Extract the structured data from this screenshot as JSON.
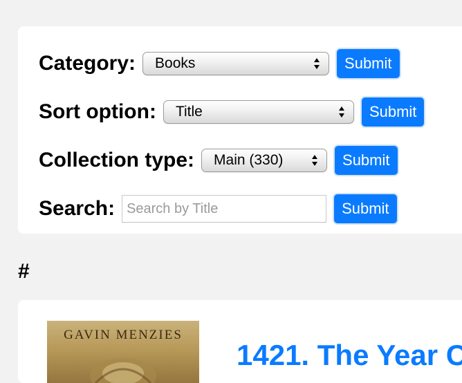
{
  "filters": {
    "category": {
      "label": "Category:",
      "selected": "Books"
    },
    "sort": {
      "label": "Sort option:",
      "selected": "Title"
    },
    "collection": {
      "label": "Collection type:",
      "selected": "Main (330)"
    },
    "search": {
      "label": "Search:",
      "placeholder": "Search by Title",
      "value": ""
    },
    "submit_label": "Submit"
  },
  "section": {
    "heading": "#"
  },
  "books": [
    {
      "cover_author": "GAVIN MENZIES",
      "title": "1421. The Year C"
    }
  ],
  "colors": {
    "accent": "#0a7bff",
    "page_background": "#f2f2f2",
    "panel_background": "#ffffff"
  }
}
